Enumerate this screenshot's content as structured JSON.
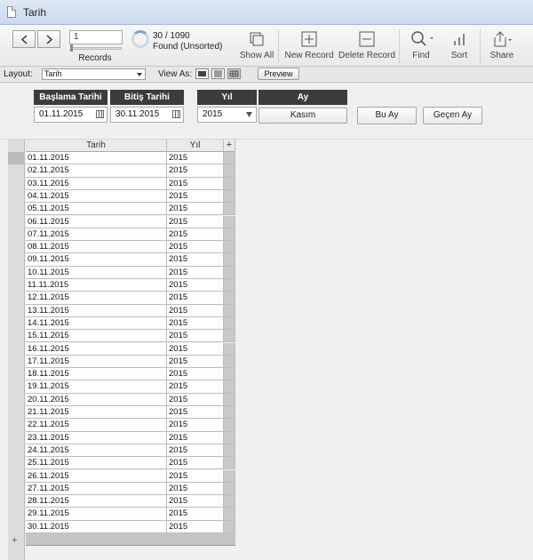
{
  "window": {
    "title": "Tarih"
  },
  "toolbar": {
    "record_input": "1",
    "records_label": "Records",
    "found_count": "30 / 1090",
    "found_status": "Found (Unsorted)",
    "buttons": {
      "show_all": "Show All",
      "new_record": "New Record",
      "delete_record": "Delete Record",
      "find": "Find",
      "sort": "Sort",
      "share": "Share"
    }
  },
  "layoutbar": {
    "layout_label": "Layout:",
    "layout_value": "Tarih",
    "view_as_label": "View As:",
    "preview_label": "Preview"
  },
  "header_fields": {
    "start_label": "Başlama Tarihi",
    "start_value": "01.11.2015",
    "end_label": "Bitiş Tarihi",
    "end_value": "30.11.2015",
    "year_label": "Yıl",
    "year_value": "2015",
    "month_label": "Ay",
    "month_value": "Kasım",
    "this_month_button": "Bu Ay",
    "last_month_button": "Geçen Ay"
  },
  "table": {
    "columns": [
      "Tarih",
      "Yıl"
    ],
    "add_column_label": "+",
    "add_row_label": "+",
    "rows": [
      [
        "01.11.2015",
        "2015"
      ],
      [
        "02.11.2015",
        "2015"
      ],
      [
        "03.11.2015",
        "2015"
      ],
      [
        "04.11.2015",
        "2015"
      ],
      [
        "05.11.2015",
        "2015"
      ],
      [
        "06.11.2015",
        "2015"
      ],
      [
        "07.11.2015",
        "2015"
      ],
      [
        "08.11.2015",
        "2015"
      ],
      [
        "09.11.2015",
        "2015"
      ],
      [
        "10.11.2015",
        "2015"
      ],
      [
        "11.11.2015",
        "2015"
      ],
      [
        "12.11.2015",
        "2015"
      ],
      [
        "13.11.2015",
        "2015"
      ],
      [
        "14.11.2015",
        "2015"
      ],
      [
        "15.11.2015",
        "2015"
      ],
      [
        "16.11.2015",
        "2015"
      ],
      [
        "17.11.2015",
        "2015"
      ],
      [
        "18.11.2015",
        "2015"
      ],
      [
        "19.11.2015",
        "2015"
      ],
      [
        "20.11.2015",
        "2015"
      ],
      [
        "21.11.2015",
        "2015"
      ],
      [
        "22.11.2015",
        "2015"
      ],
      [
        "23.11.2015",
        "2015"
      ],
      [
        "24.11.2015",
        "2015"
      ],
      [
        "25.11.2015",
        "2015"
      ],
      [
        "26.11.2015",
        "2015"
      ],
      [
        "27.11.2015",
        "2015"
      ],
      [
        "28.11.2015",
        "2015"
      ],
      [
        "29.11.2015",
        "2015"
      ],
      [
        "30.11.2015",
        "2015"
      ]
    ]
  }
}
